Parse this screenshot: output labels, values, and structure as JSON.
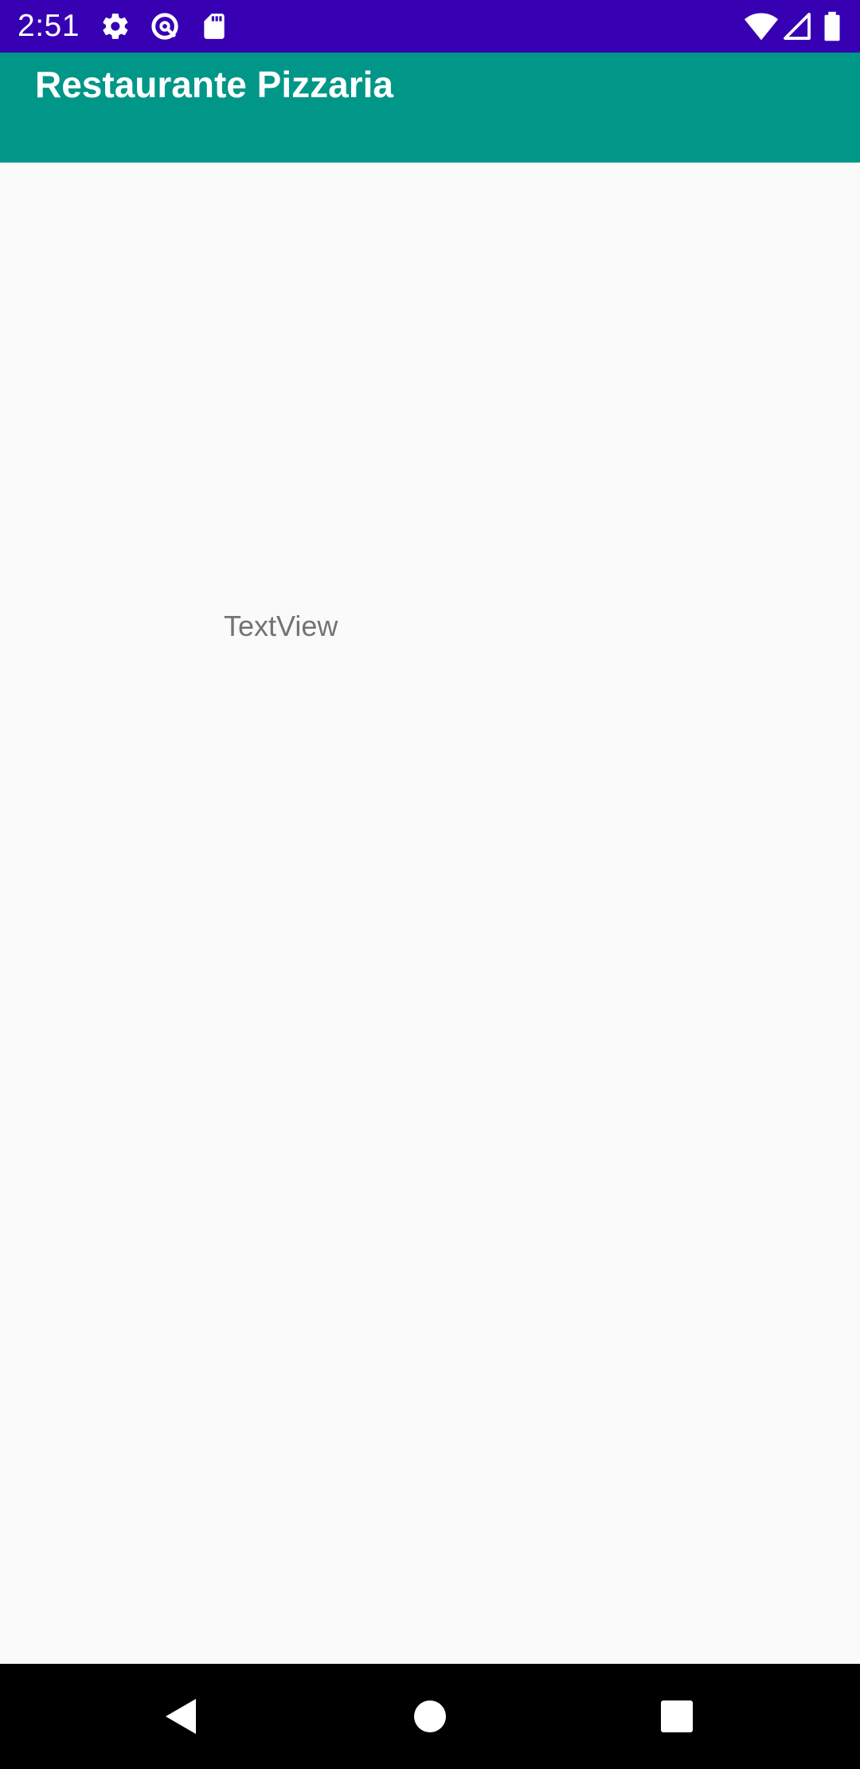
{
  "status_bar": {
    "time": "2:51",
    "icons": [
      "gear-icon",
      "data-saver-icon",
      "sd-card-icon",
      "wifi-icon",
      "signal-icon",
      "battery-icon"
    ],
    "background_color": "#3700b3"
  },
  "app_bar": {
    "title": "Restaurante Pizzaria",
    "background_color": "#009688"
  },
  "main": {
    "text_view": "TextView"
  },
  "nav_bar": {
    "icons": [
      "back-icon",
      "home-icon",
      "recents-icon"
    ]
  }
}
